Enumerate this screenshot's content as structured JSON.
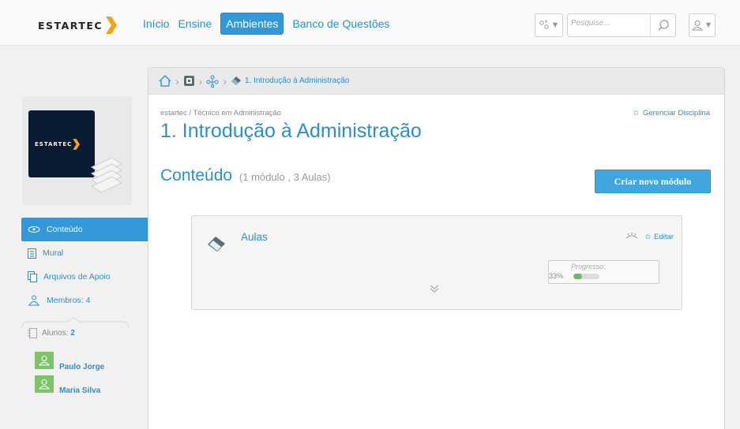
{
  "brand": {
    "name": "ESTARTEC"
  },
  "nav": {
    "items": [
      "Início",
      "Ensine",
      "Ambientes",
      "Banco de Questões"
    ],
    "active": "Ambientes"
  },
  "search": {
    "placeholder": "Pesquise..."
  },
  "course": {
    "thumb_logo": "ESTARTEC"
  },
  "sidebar": {
    "items": [
      {
        "label": "Conteúdo",
        "icon": "eye-icon",
        "active": true
      },
      {
        "label": "Mural",
        "icon": "document-icon"
      },
      {
        "label": "Arquivos de Apoio",
        "icon": "files-icon"
      },
      {
        "label": "Membros: 4",
        "icon": "group-icon"
      }
    ],
    "students_label": "Alunos:",
    "students_count": "2",
    "students": [
      "Paulo Jorge",
      "Maria Silva"
    ]
  },
  "breadcrumb": {
    "current": "1. Introdução à Administração"
  },
  "page": {
    "path_org": "estartec",
    "path_sep": " / ",
    "path_course": "Técnico em Administração",
    "title": "1. Introdução à Administração",
    "manage_label": "Gerenciar Disciplina",
    "section_title": "Conteúdo",
    "section_count": "(1 módulo , 3 Aulas)",
    "new_module_label": "Criar novo módulo"
  },
  "module": {
    "name": "Aulas",
    "edit_label": "Editar",
    "progress_label": "Progresso:",
    "progress_text": "33%",
    "progress_value": 0.33
  },
  "colors": {
    "accent": "#3497d6",
    "link": "#2c8fcc",
    "progress": "#6cbd5a",
    "avatar": "#7cc36a"
  }
}
